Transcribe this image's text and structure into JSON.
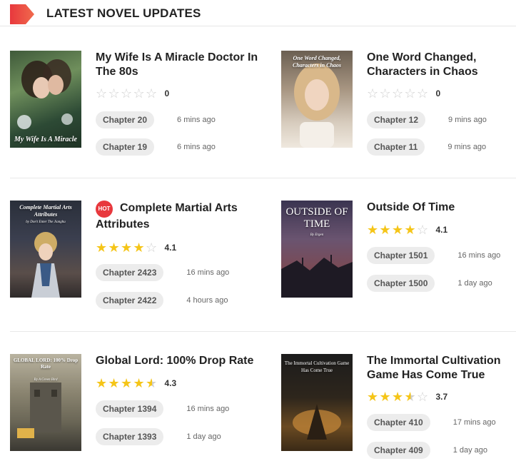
{
  "section": {
    "title": "LATEST NOVEL UPDATES"
  },
  "novels": [
    {
      "title": "My Wife Is A Miracle Doctor In The 80s",
      "cover_text": "My Wife Is A Miracle",
      "rating_text": "0",
      "stars": [
        0,
        0,
        0,
        0,
        0
      ],
      "chapters": [
        {
          "label": "Chapter 20",
          "time": "6 mins ago"
        },
        {
          "label": "Chapter 19",
          "time": "6 mins ago"
        }
      ]
    },
    {
      "title": "One Word Changed, Characters in Chaos",
      "cover_text": "One Word Changed, Characters in Chaos",
      "rating_text": "0",
      "stars": [
        0,
        0,
        0,
        0,
        0
      ],
      "chapters": [
        {
          "label": "Chapter 12",
          "time": "9 mins ago"
        },
        {
          "label": "Chapter 11",
          "time": "9 mins ago"
        }
      ]
    },
    {
      "title": "Complete Martial Arts Attributes",
      "hot_label": "HOT",
      "cover_text": "Complete Martial Arts Attributes",
      "cover_author": "by Don't Enter The Jianghu",
      "rating_text": "4.1",
      "stars": [
        1,
        1,
        1,
        1,
        0
      ],
      "chapters": [
        {
          "label": "Chapter 2423",
          "time": "16 mins ago"
        },
        {
          "label": "Chapter 2422",
          "time": "4 hours ago"
        }
      ]
    },
    {
      "title": "Outside Of Time",
      "cover_text": "OUTSIDE OF TIME",
      "cover_author": "By Ergen",
      "rating_text": "4.1",
      "stars": [
        1,
        1,
        1,
        1,
        0
      ],
      "chapters": [
        {
          "label": "Chapter 1501",
          "time": "16 mins ago"
        },
        {
          "label": "Chapter 1500",
          "time": "1 day ago"
        }
      ]
    },
    {
      "title": "Global Lord: 100% Drop Rate",
      "cover_text": "GLOBAL LORD: 100% Drop Rate",
      "cover_author": "By A Green Bird",
      "rating_text": "4.3",
      "stars": [
        1,
        1,
        1,
        1,
        0.5
      ],
      "chapters": [
        {
          "label": "Chapter 1394",
          "time": "16 mins ago"
        },
        {
          "label": "Chapter 1393",
          "time": "1 day ago"
        }
      ]
    },
    {
      "title": "The Immortal Cultivation Game Has Come True",
      "cover_text": "The Immortal Cultivation Game Has Come True",
      "rating_text": "3.7",
      "stars": [
        1,
        1,
        1,
        0.5,
        0
      ],
      "chapters": [
        {
          "label": "Chapter 410",
          "time": "17 mins ago"
        },
        {
          "label": "Chapter 409",
          "time": "1 day ago"
        }
      ]
    }
  ],
  "colors": {
    "accent": "#e8383d",
    "star": "#f5c518",
    "star_empty": "#cfcfcf",
    "chip_bg": "#ececec"
  },
  "icons": {
    "section_flag": "ribbon-flag-icon",
    "star": "star-icon",
    "hot": "hot-badge-icon"
  }
}
